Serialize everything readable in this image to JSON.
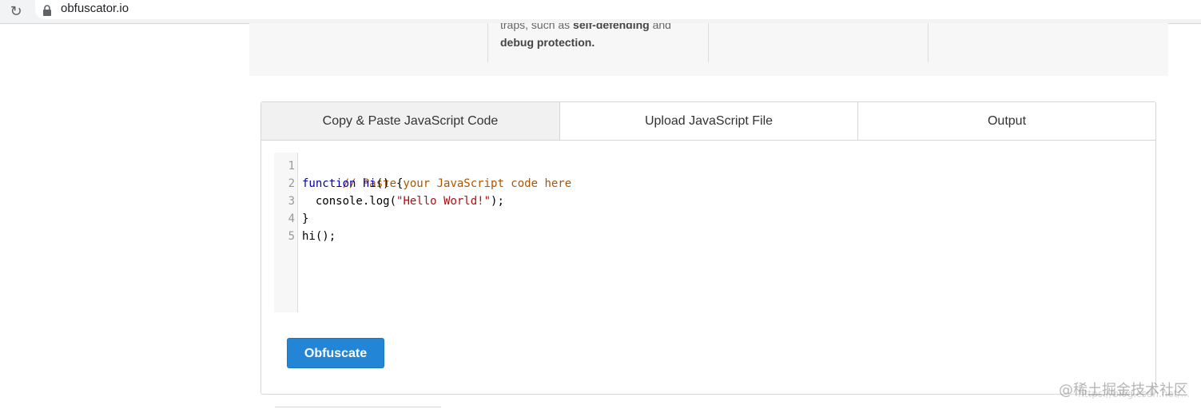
{
  "browser": {
    "url": "obfuscator.io",
    "reload_icon": "reload-icon",
    "lock_icon": "lock-icon"
  },
  "feature": {
    "line1_a": "traps",
    "line1_b": ", such as ",
    "line1_bold": "self-defending",
    "line1_c": " and",
    "line2_bold": "debug protection."
  },
  "tabs": [
    {
      "label": "Copy & Paste JavaScript Code",
      "active": true
    },
    {
      "label": "Upload JavaScript File",
      "active": false
    },
    {
      "label": "Output",
      "active": false
    }
  ],
  "editor": {
    "line_numbers": [
      "1",
      "2",
      "3",
      "4",
      "5"
    ],
    "lines": {
      "l1_comment": "// Paste your JavaScript code here",
      "l2_keyword": "function",
      "l2_name": "hi",
      "l2_rest": "() {",
      "l3_pre": "  console.log(",
      "l3_string": "\"Hello World!\"",
      "l3_post": ");",
      "l4": "}",
      "l5": "hi();"
    }
  },
  "actions": {
    "obfuscate_label": "Obfuscate"
  },
  "watermark": {
    "text": "@稀土掘金技术社区",
    "url": "https://blog.csdn.net/..."
  },
  "colors": {
    "primary_button": "#2385d6",
    "active_tab_bg": "#f1f1f1",
    "comment": "#a85500",
    "keyword": "#0000aa",
    "string": "#aa1111"
  }
}
